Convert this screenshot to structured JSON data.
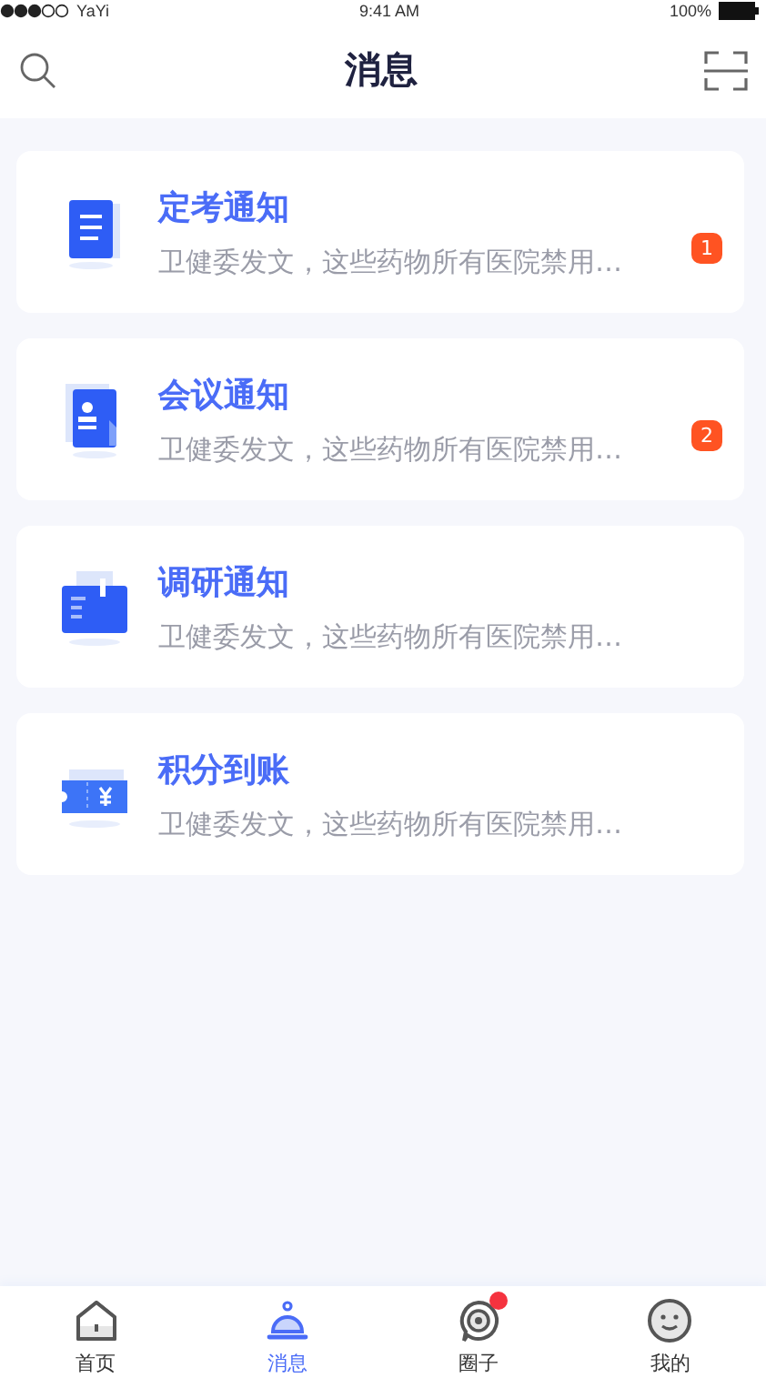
{
  "status_bar": {
    "carrier": "YaYi",
    "time": "9:41 AM",
    "battery": "100%"
  },
  "header": {
    "title": "消息"
  },
  "messages": [
    {
      "kind": "clipboard",
      "title": "定考通知",
      "preview": "卫健委发文，这些药物所有医院禁用…",
      "badge": "1"
    },
    {
      "kind": "contact",
      "title": "会议通知",
      "preview": "卫健委发文，这些药物所有医院禁用…",
      "badge": "2"
    },
    {
      "kind": "folder",
      "title": "调研通知",
      "preview": "卫健委发文，这些药物所有医院禁用…"
    },
    {
      "kind": "ticket",
      "title": "积分到账",
      "preview": "卫健委发文，这些药物所有医院禁用…"
    }
  ],
  "tab_bar": [
    {
      "kind": "home",
      "label": "首页",
      "selected": false,
      "dot": false
    },
    {
      "kind": "bell",
      "label": "消息",
      "selected": true,
      "dot": false
    },
    {
      "kind": "circle",
      "label": "圈子",
      "selected": false,
      "dot": true
    },
    {
      "kind": "me",
      "label": "我的",
      "selected": false,
      "dot": false
    }
  ]
}
